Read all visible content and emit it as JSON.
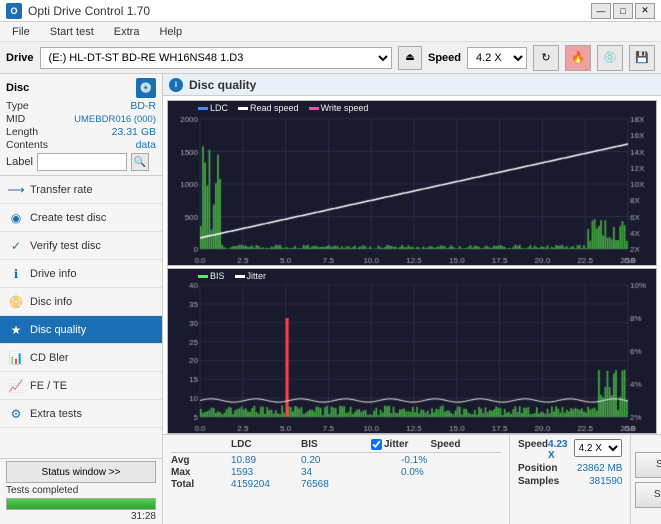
{
  "titlebar": {
    "title": "Opti Drive Control 1.70",
    "icon_label": "O",
    "controls": [
      "—",
      "□",
      "✕"
    ]
  },
  "menubar": {
    "items": [
      "File",
      "Start test",
      "Extra",
      "Help"
    ]
  },
  "drivebar": {
    "label": "Drive",
    "drive_value": "(E:)  HL-DT-ST BD-RE  WH16NS48 1.D3",
    "speed_label": "Speed",
    "speed_value": "4.2 X"
  },
  "disc": {
    "title": "Disc",
    "type_label": "Type",
    "type_value": "BD-R",
    "mid_label": "MID",
    "mid_value": "UMEBDR016 (000)",
    "length_label": "Length",
    "length_value": "23.31 GB",
    "contents_label": "Contents",
    "contents_value": "data",
    "label_label": "Label",
    "label_placeholder": ""
  },
  "nav": {
    "items": [
      {
        "id": "transfer-rate",
        "label": "Transfer rate",
        "icon": "⟶"
      },
      {
        "id": "create-test-disc",
        "label": "Create test disc",
        "icon": "◉"
      },
      {
        "id": "verify-test-disc",
        "label": "Verify test disc",
        "icon": "✓"
      },
      {
        "id": "drive-info",
        "label": "Drive info",
        "icon": "ℹ"
      },
      {
        "id": "disc-info",
        "label": "Disc info",
        "icon": "📀"
      },
      {
        "id": "disc-quality",
        "label": "Disc quality",
        "icon": "★",
        "active": true
      },
      {
        "id": "cd-bler",
        "label": "CD Bler",
        "icon": "📊"
      },
      {
        "id": "fe-te",
        "label": "FE / TE",
        "icon": "📈"
      },
      {
        "id": "extra-tests",
        "label": "Extra tests",
        "icon": "⚙"
      }
    ]
  },
  "status": {
    "window_btn": "Status window >>",
    "status_text": "Tests completed",
    "progress": 100,
    "time": "31:28"
  },
  "disc_quality": {
    "title": "Disc quality",
    "chart1": {
      "legend": [
        {
          "label": "LDC",
          "color": "#4488ff"
        },
        {
          "label": "Read speed",
          "color": "#ffffff"
        },
        {
          "label": "Write speed",
          "color": "#ff44aa"
        }
      ],
      "y_max": 2000,
      "y_labels": [
        "2000",
        "1500",
        "1000",
        "500",
        "0"
      ],
      "y_right_labels": [
        "18X",
        "16X",
        "14X",
        "12X",
        "10X",
        "8X",
        "6X",
        "4X",
        "2X"
      ],
      "x_labels": [
        "0.0",
        "2.5",
        "5.0",
        "7.5",
        "10.0",
        "12.5",
        "15.0",
        "17.5",
        "20.0",
        "22.5",
        "25.0 GB"
      ]
    },
    "chart2": {
      "legend": [
        {
          "label": "BIS",
          "color": "#44ff44"
        },
        {
          "label": "Jitter",
          "color": "#ffffff"
        }
      ],
      "y_max": 40,
      "y_labels": [
        "40",
        "35",
        "30",
        "25",
        "20",
        "15",
        "10",
        "5"
      ],
      "y_right_labels": [
        "10%",
        "8%",
        "6%",
        "4%",
        "2%"
      ],
      "x_labels": [
        "0.0",
        "2.5",
        "5.0",
        "7.5",
        "10.0",
        "12.5",
        "15.0",
        "17.5",
        "20.0",
        "22.5",
        "25.0 GB"
      ]
    }
  },
  "stats": {
    "headers": [
      "",
      "LDC",
      "BIS",
      "",
      "Jitter",
      "Speed"
    ],
    "jitter_checked": true,
    "jitter_label": "Jitter",
    "avg_label": "Avg",
    "avg_ldc": "10.89",
    "avg_bis": "0.20",
    "avg_jitter": "-0.1%",
    "max_label": "Max",
    "max_ldc": "1593",
    "max_bis": "34",
    "max_jitter": "0.0%",
    "total_label": "Total",
    "total_ldc": "4159204",
    "total_bis": "76568",
    "speed_label": "Speed",
    "speed_value": "4.23 X",
    "speed_select": "4.2 X",
    "position_label": "Position",
    "position_value": "23862 MB",
    "samples_label": "Samples",
    "samples_value": "381590",
    "start_full_label": "Start full",
    "start_part_label": "Start part"
  }
}
